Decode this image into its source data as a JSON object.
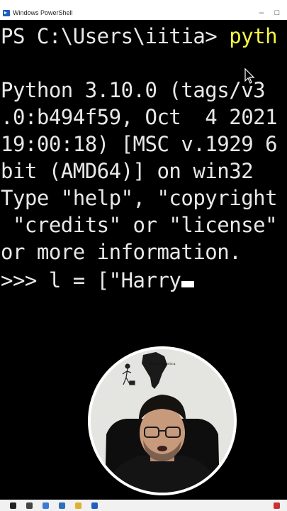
{
  "window": {
    "title": "Windows PowerShell",
    "minimize_glyph": "–",
    "maximize_glyph": "□"
  },
  "terminal": {
    "prompt_prefix": "PS C:\\Users\\iitia> ",
    "prompt_command": "pyth",
    "lines": [
      "Python 3.10.0 (tags/v3",
      ".0:b494f59, Oct  4 2021",
      "19:00:18) [MSC v.1929 6",
      "bit (AMD64)] on win32",
      "Type \"help\", \"copyright",
      " \"credits\" or \"license\"",
      "or more information."
    ],
    "repl_input": ">>> l = [\"Harry"
  },
  "webcam_overlay": {
    "map_label": "South America"
  },
  "colors": {
    "terminal_bg": "#000000",
    "terminal_fg": "#e8e8e8",
    "command_highlight": "#f5f543",
    "titlebar_bg": "#ffffff"
  }
}
